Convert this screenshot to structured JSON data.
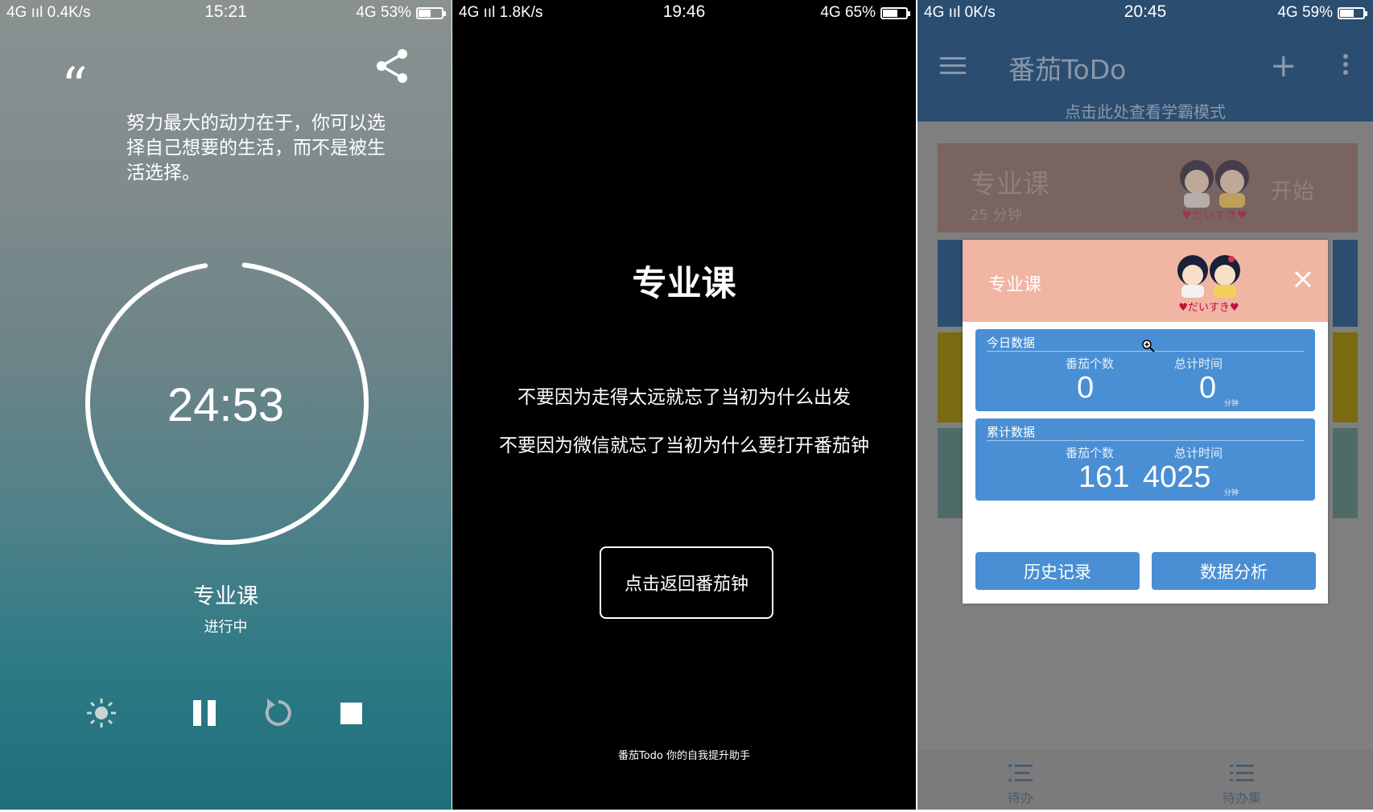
{
  "panel1": {
    "status": {
      "left": "4G ııl  0.4K/s",
      "time": "15:21",
      "right": "4G 53%",
      "battery_level": 0.53
    },
    "quote_mark": "“",
    "quote": "努力最大的动力在于，你可以选择自己想要的生活，而不是被生活选择。",
    "timer": "24:53",
    "timer_progress": 0.995,
    "task_name": "专业课",
    "task_state": "进行中",
    "controls": [
      "brightness-icon",
      "pause-icon",
      "reset-icon",
      "stop-icon"
    ]
  },
  "panel2": {
    "status": {
      "left": "4G ııl  1.8K/s",
      "time": "19:46",
      "right": "4G 65%",
      "battery_level": 0.65
    },
    "title": "专业课",
    "line1": "不要因为走得太远就忘了当初为什么出发",
    "line2": "不要因为微信就忘了当初为什么要打开番茄钟",
    "back_button": "点击返回番茄钟",
    "footer": "番茄Todo 你的自我提升助手"
  },
  "panel3": {
    "status": {
      "left": "4G ııl  0K/s",
      "time": "20:45",
      "right": "4G 59%",
      "battery_level": 0.59
    },
    "app_title": "番茄ToDo",
    "plus": "+",
    "banner": "点击此处查看学霸模式",
    "card": {
      "name": "专业课",
      "duration": "25 分钟",
      "start": "开始"
    },
    "strip_colors": [
      "#2b4d70",
      "#7a6a10",
      "#4f6b68"
    ],
    "modal": {
      "title": "专业课",
      "today": {
        "section": "今日数据",
        "count_label": "番茄个数",
        "count": "0",
        "time_label": "总计时间",
        "time": "0",
        "unit": "分钟"
      },
      "total": {
        "section": "累计数据",
        "count_label": "番茄个数",
        "count": "161",
        "time_label": "总计时间",
        "time": "4025",
        "unit": "分钟"
      },
      "history_button": "历史记录",
      "analysis_button": "数据分析"
    },
    "nav": [
      {
        "label": "待办",
        "icon": "todo-list-icon"
      },
      {
        "label": "待办集",
        "icon": "todo-collection-icon"
      }
    ]
  }
}
